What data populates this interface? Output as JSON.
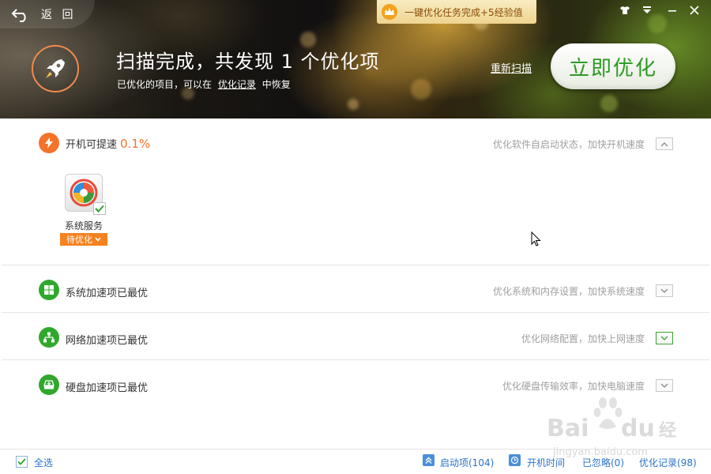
{
  "header": {
    "back_label": "返 回",
    "task_banner": "一键优化任务完成+5经验值",
    "scan_title": "扫描完成，共发现 1 个优化项",
    "scan_sub_prefix": "已优化的项目，可以在",
    "scan_sub_link": "优化记录",
    "scan_sub_suffix": "中恢复",
    "rescan_label": "重新扫描",
    "optimize_label": "立即优化",
    "window_controls": [
      "shirt-icon",
      "menu-icon",
      "minimize-icon",
      "close-icon"
    ]
  },
  "sections": [
    {
      "title": "开机可提速",
      "percent": "0.1%",
      "description": "优化软件自启动状态，加快开机速度",
      "icon": "lightning-icon",
      "expanded": true,
      "items": [
        {
          "label": "系统服务",
          "status": "待优化",
          "checked": true
        }
      ]
    },
    {
      "title": "系统加速项已最优",
      "description": "优化系统和内存设置，加快系统速度",
      "icon": "windows-icon",
      "expanded": false
    },
    {
      "title": "网络加速项已最优",
      "description": "优化网络配置，加快上网速度",
      "icon": "network-icon",
      "expanded": false
    },
    {
      "title": "硬盘加速项已最优",
      "description": "优化硬盘传输效率，加快电脑速度",
      "icon": "harddisk-icon",
      "expanded": false
    }
  ],
  "footer": {
    "select_all_label": "全选",
    "select_all_checked": true,
    "startup_items": "启动项(104)",
    "boot_time": "开机时间",
    "ignored": "已忽略(0)",
    "opt_records": "优化记录(98)"
  },
  "watermark": {
    "brand": "Bai du 经验",
    "url": "jingyan.baidu.com"
  },
  "colors": {
    "accent_orange": "#f5732a",
    "accent_green": "#30a82d",
    "link_blue": "#2b73c6"
  }
}
